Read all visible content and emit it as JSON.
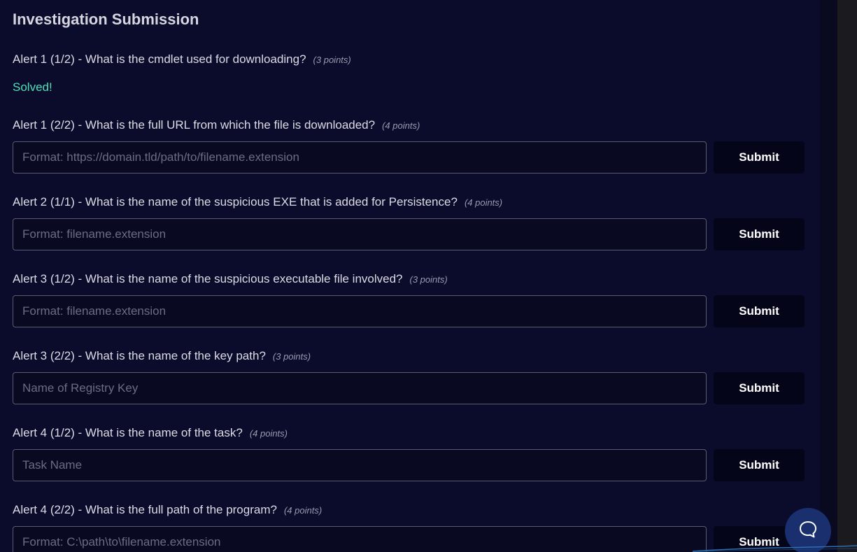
{
  "section_title": "Investigation Submission",
  "questions": [
    {
      "label": "Alert 1 (1/2) - What is the cmdlet used for downloading?",
      "points": "(3 points)",
      "status": "Solved!"
    },
    {
      "label": "Alert 1 (2/2) - What is the full URL from which the file is downloaded?",
      "points": "(4 points)",
      "placeholder": "Format: https://domain.tld/path/to/filename.extension",
      "submit_label": "Submit"
    },
    {
      "label": "Alert 2 (1/1) - What is the name of the suspicious EXE that is added for Persistence?",
      "points": "(4 points)",
      "placeholder": "Format: filename.extension",
      "submit_label": "Submit"
    },
    {
      "label": "Alert 3 (1/2) - What is the name of the suspicious executable file involved?",
      "points": "(3 points)",
      "placeholder": "Format: filename.extension",
      "submit_label": "Submit"
    },
    {
      "label": "Alert 3 (2/2) - What is the name of the key path?",
      "points": "(3 points)",
      "placeholder": "Name of Registry Key",
      "submit_label": "Submit"
    },
    {
      "label": "Alert 4 (1/2) - What is the name of the task?",
      "points": "(4 points)",
      "placeholder": "Task Name",
      "submit_label": "Submit"
    },
    {
      "label": "Alert 4 (2/2) - What is the full path of the program?",
      "points": "(4 points)",
      "placeholder": "Format: C:\\path\\to\\filename.extension",
      "submit_label": "Submit"
    }
  ],
  "chat_icon": "chat-bubble-icon",
  "colors": {
    "background": "#0b0b2b",
    "solved": "#4fe0b8",
    "submit_bg": "#05051a",
    "chat_bg": "#1a2f6e"
  }
}
